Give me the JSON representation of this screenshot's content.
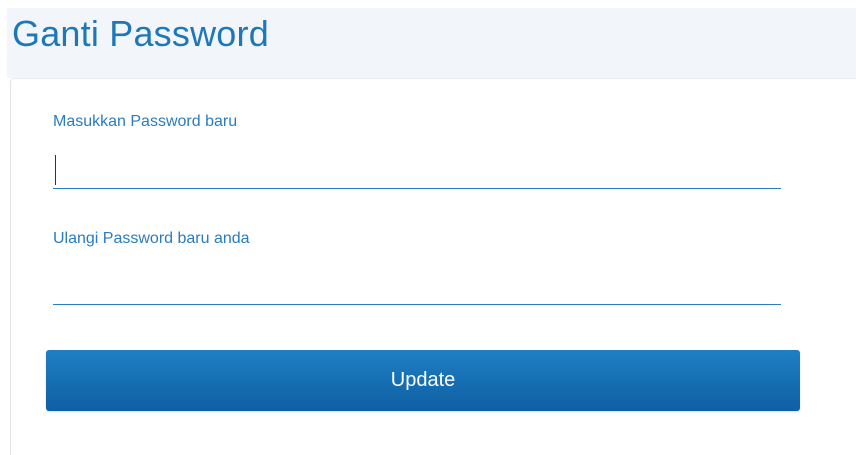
{
  "page": {
    "title": "Ganti Password"
  },
  "form": {
    "new_password_label": "Masukkan Password baru",
    "new_password_value": "",
    "repeat_password_label": "Ulangi Password baru anda",
    "repeat_password_value": "",
    "update_label": "Update"
  },
  "colors": {
    "accent": "#1d77b8",
    "button_top": "#1f7fc3",
    "button_bottom": "#0f5fa3",
    "header_bg": "#f2f6fa"
  }
}
